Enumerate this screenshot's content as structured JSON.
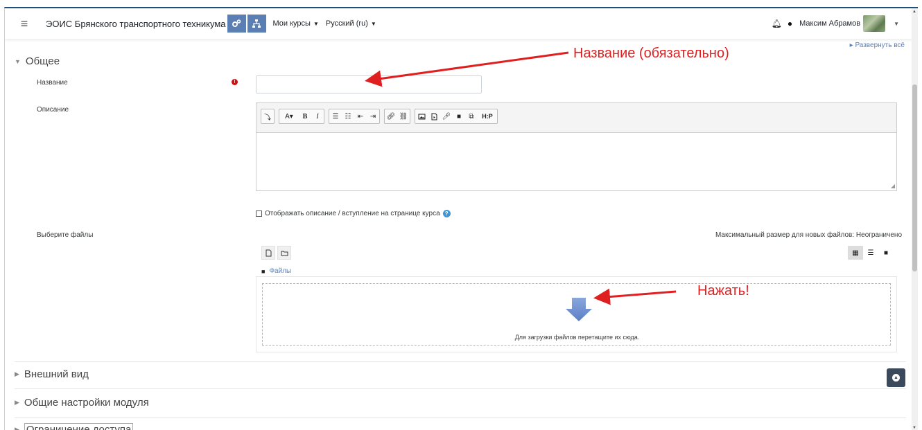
{
  "navbar": {
    "site_name": "ЭОИС Брянского транспортного техникума",
    "my_courses": "Мои курсы",
    "language": "Русский (ru)",
    "user_name": "Максим Абрамов"
  },
  "page": {
    "expand_all": "Развернуть всё"
  },
  "general": {
    "heading": "Общее",
    "name_label": "Название",
    "name_value": "",
    "description_label": "Описание",
    "show_description_label": "Отображать описание / вступление на странице курса",
    "select_files_label": "Выберите файлы",
    "max_size_text": "Максимальный размер для новых файлов: Неограничено",
    "files_folder": "Файлы",
    "dropzone_text": "Для загрузки файлов перетащите их сюда."
  },
  "sections": {
    "appearance": "Внешний вид",
    "common_settings": "Общие настройки модуля",
    "access_restriction": "Ограничение доступа"
  },
  "annotations": {
    "name_required": "Название (обязательно)",
    "press": "Нажать!"
  },
  "colors": {
    "nav_button": "#5b7fb3",
    "annotation": "#e02020",
    "required_icon": "#cc1111",
    "upload_arrow": "#6f8fd0"
  }
}
